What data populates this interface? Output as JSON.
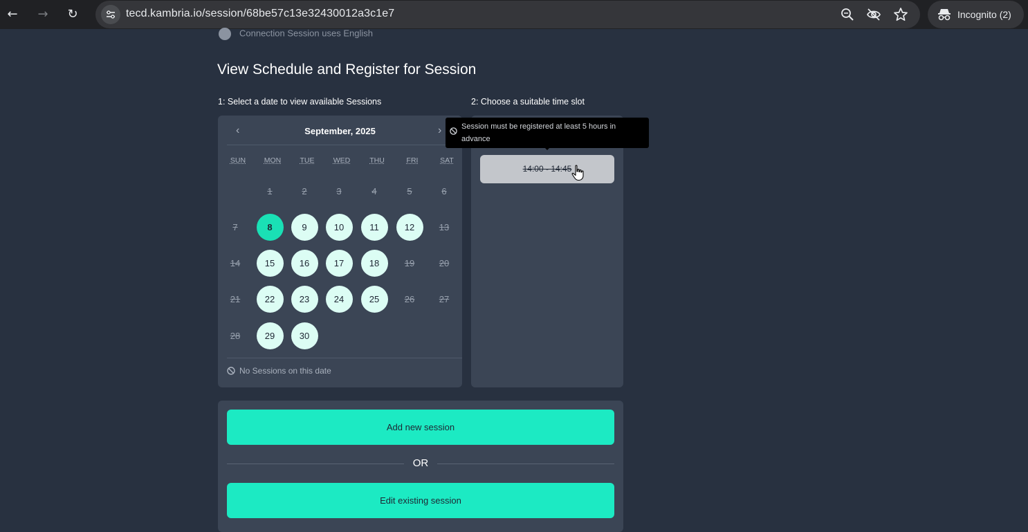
{
  "browser": {
    "url": "tecd.kambria.io/session/68be57c13e32430012a3c1e7",
    "incognito_label": "Incognito (2)"
  },
  "page": {
    "top_line": "Connection Session uses English",
    "heading": "View Schedule and Register for Session",
    "step1": "1: Select a date to view available Sessions",
    "step2": "2: Choose a suitable time slot"
  },
  "calendar": {
    "month_label": "September, 2025",
    "prev": "‹",
    "next": "›",
    "weekdays": [
      "SUN",
      "MON",
      "TUE",
      "WED",
      "THU",
      "FRI",
      "SAT"
    ],
    "weeks": [
      [
        null,
        {
          "d": "1",
          "s": "off"
        },
        {
          "d": "2",
          "s": "off"
        },
        {
          "d": "3",
          "s": "off"
        },
        {
          "d": "4",
          "s": "off"
        },
        {
          "d": "5",
          "s": "off"
        },
        {
          "d": "6",
          "s": "off"
        }
      ],
      [
        {
          "d": "7",
          "s": "off"
        },
        {
          "d": "8",
          "s": "selected"
        },
        {
          "d": "9",
          "s": "avail"
        },
        {
          "d": "10",
          "s": "avail"
        },
        {
          "d": "11",
          "s": "avail"
        },
        {
          "d": "12",
          "s": "avail"
        },
        {
          "d": "13",
          "s": "off"
        }
      ],
      [
        {
          "d": "14",
          "s": "off"
        },
        {
          "d": "15",
          "s": "avail"
        },
        {
          "d": "16",
          "s": "avail"
        },
        {
          "d": "17",
          "s": "avail"
        },
        {
          "d": "18",
          "s": "avail"
        },
        {
          "d": "19",
          "s": "off"
        },
        {
          "d": "20",
          "s": "off"
        }
      ],
      [
        {
          "d": "21",
          "s": "off"
        },
        {
          "d": "22",
          "s": "avail"
        },
        {
          "d": "23",
          "s": "avail"
        },
        {
          "d": "24",
          "s": "avail"
        },
        {
          "d": "25",
          "s": "avail"
        },
        {
          "d": "26",
          "s": "off"
        },
        {
          "d": "27",
          "s": "off"
        }
      ],
      [
        {
          "d": "28",
          "s": "off"
        },
        {
          "d": "29",
          "s": "avail"
        },
        {
          "d": "30",
          "s": "avail"
        },
        null,
        null,
        null,
        null
      ]
    ],
    "no_sessions": "No Sessions on this date"
  },
  "slots": {
    "time_slot": "14:00 - 14:45",
    "tooltip": "Session must be registered at least 5 hours in advance"
  },
  "actions": {
    "add_label": "Add new session",
    "or_label": "OR",
    "edit_label": "Edit existing session"
  },
  "colors": {
    "accent": "#1ceac3",
    "selected_day": "#1ae0b5",
    "available_day": "#dcfdf4",
    "background": "#283140",
    "panel": "#3b4555"
  }
}
